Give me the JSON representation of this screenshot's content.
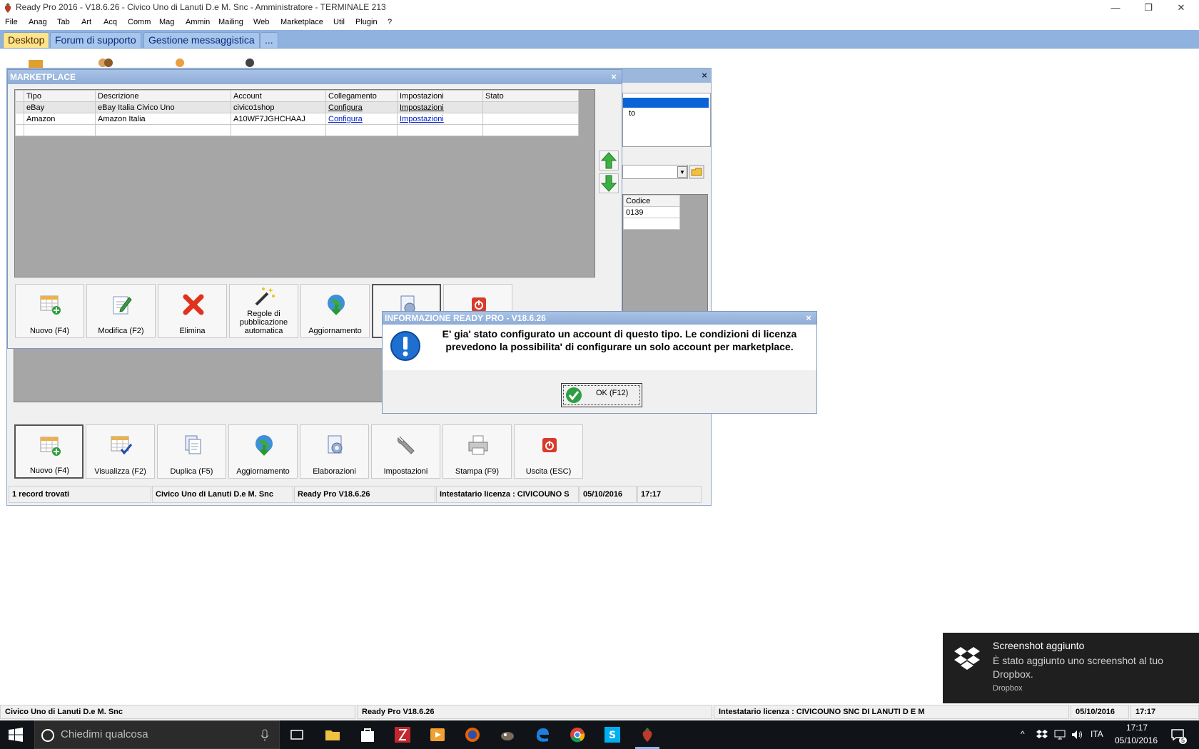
{
  "window": {
    "title": "Ready Pro 2016 - V18.6.26 - Civico Uno di Lanuti D.e M. Snc - Amministratore - TERMINALE 213",
    "minimize": "—",
    "restore": "❐",
    "close": "✕"
  },
  "menu": [
    "File",
    "Anag",
    "Tab",
    "Art",
    "Acq",
    "Comm",
    "Mag",
    "Ammin",
    "Mailing",
    "Web",
    "Marketplace",
    "Util",
    "Plugin",
    "?"
  ],
  "tabs": [
    "Desktop",
    "Forum di supporto",
    "Gestione messaggistica",
    "..."
  ],
  "main_window": {
    "close": "×",
    "fragment_text": "to",
    "code_header": "Codice",
    "code_value": "0139",
    "toolbar": [
      "Nuovo (F4)",
      "Visualizza (F2)",
      "Duplica (F5)",
      "Aggiornamento",
      "Elaborazioni",
      "Impostazioni",
      "Stampa (F9)",
      "Uscita (ESC)"
    ],
    "status": [
      "1 record trovati",
      "Civico Uno di Lanuti D.e M. Snc",
      "Ready Pro V18.6.26",
      "Intestatario licenza : CIVICOUNO S",
      "05/10/2016",
      "17:17"
    ]
  },
  "marketplace": {
    "title": "MARKETPLACE",
    "close": "×",
    "columns": [
      "Tipo",
      "Descrizione",
      "Account",
      "Collegamento",
      "Impostazioni",
      "Stato"
    ],
    "rows": [
      {
        "tipo": "eBay",
        "descrizione": "eBay Italia Civico Uno",
        "account": "civico1shop",
        "collegamento": "Configura",
        "impostazioni": "Impostazioni",
        "stato": ""
      },
      {
        "tipo": "Amazon",
        "descrizione": "Amazon Italia",
        "account": "A10WF7JGHCHAAJ",
        "collegamento": "Configura",
        "impostazioni": "Impostazioni",
        "stato": ""
      }
    ],
    "toolbar": [
      "Nuovo (F4)",
      "Modifica (F2)",
      "Elimina",
      "Regole di pubblicazione automatica",
      "Aggiornamento"
    ]
  },
  "dialog": {
    "title": "INFORMAZIONE READY PRO - V18.6.26",
    "close": "×",
    "message": "E' gia' stato configurato un account di questo tipo. Le condizioni di licenza prevedono la possibilita' di configurare un solo account per marketplace.",
    "ok_label": "OK (F12)"
  },
  "app_status": [
    "Civico Uno di Lanuti D.e M. Snc",
    "Ready Pro V18.6.26",
    "Intestatario licenza : CIVICOUNO SNC DI LANUTI D E M",
    "05/10/2016",
    "17:17"
  ],
  "toast": {
    "title": "Screenshot aggiunto",
    "body": "È stato aggiunto uno screenshot al tuo Dropbox.",
    "source": "Dropbox"
  },
  "taskbar": {
    "search_placeholder": "Chiedimi qualcosa",
    "lang": "ITA",
    "time": "17:17",
    "date": "05/10/2016",
    "notif_count": "5"
  }
}
